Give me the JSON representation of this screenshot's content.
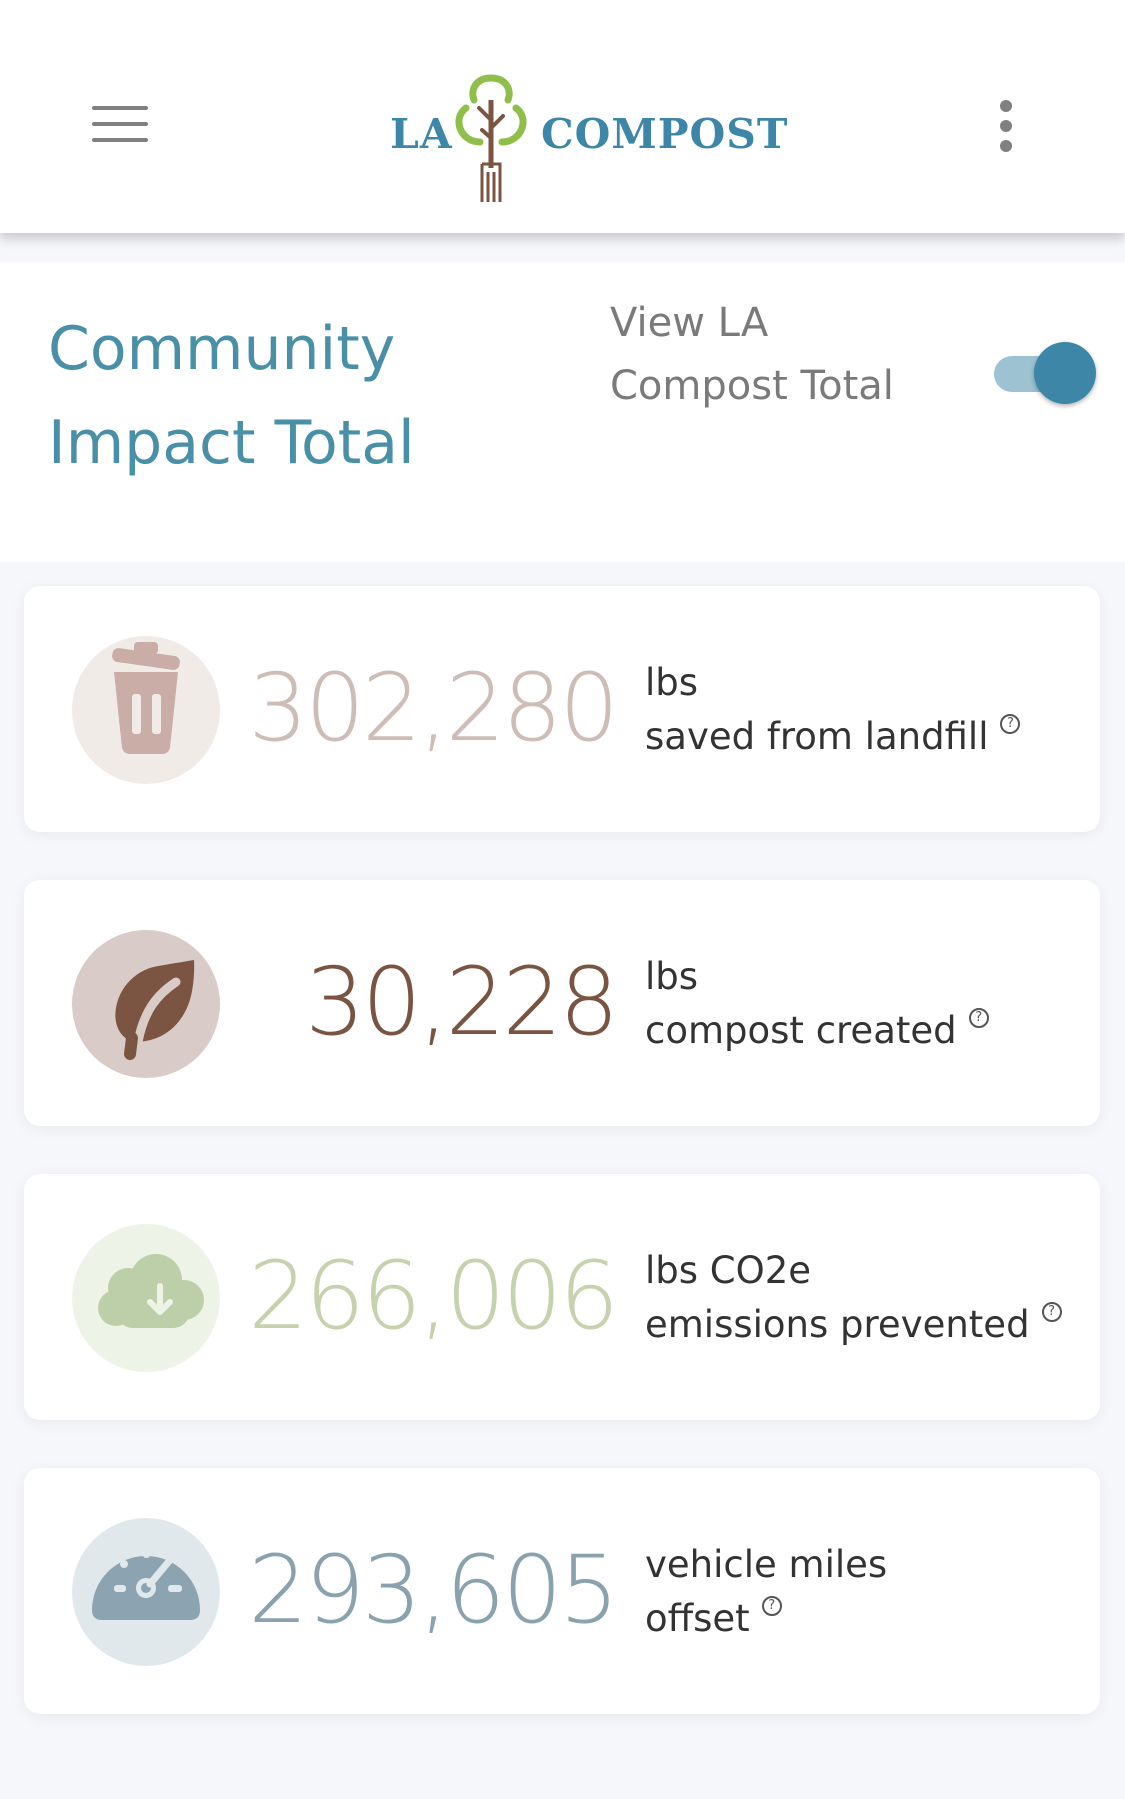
{
  "header": {
    "logo_left": "LA",
    "logo_right": "COMPOST",
    "menu_icon": "hamburger-menu-icon",
    "more_icon": "more-vertical-icon"
  },
  "title": {
    "line1": "Community",
    "line2": "Impact Total"
  },
  "toggle": {
    "label_line1": "View LA",
    "label_line2": "Compost Total",
    "on": true
  },
  "stats": [
    {
      "value": "302,280",
      "unit": "lbs",
      "desc": "saved from landfill",
      "icon": "trash-icon",
      "value_color": "#cdbdb6",
      "icon_color": "#c9ada6",
      "circle_color": "#f1ebe8"
    },
    {
      "value": "30,228",
      "unit": "lbs",
      "desc": "compost created",
      "icon": "leaf-icon",
      "value_color": "#7a5443",
      "icon_color": "#7b5542",
      "circle_color": "#d9cbc7"
    },
    {
      "value": "266,006",
      "unit": "lbs CO2e",
      "desc": "emissions prevented",
      "icon": "cloud-download-icon",
      "value_color": "#c6d2ad",
      "icon_color": "#bccfa9",
      "circle_color": "#eef3e7"
    },
    {
      "value": "293,605",
      "unit": "vehicle miles",
      "desc": "offset",
      "icon": "speedometer-icon",
      "value_color": "#8aa1ae",
      "icon_color": "#8ca4b1",
      "circle_color": "#e1e8ec"
    }
  ],
  "help_glyph": "?"
}
